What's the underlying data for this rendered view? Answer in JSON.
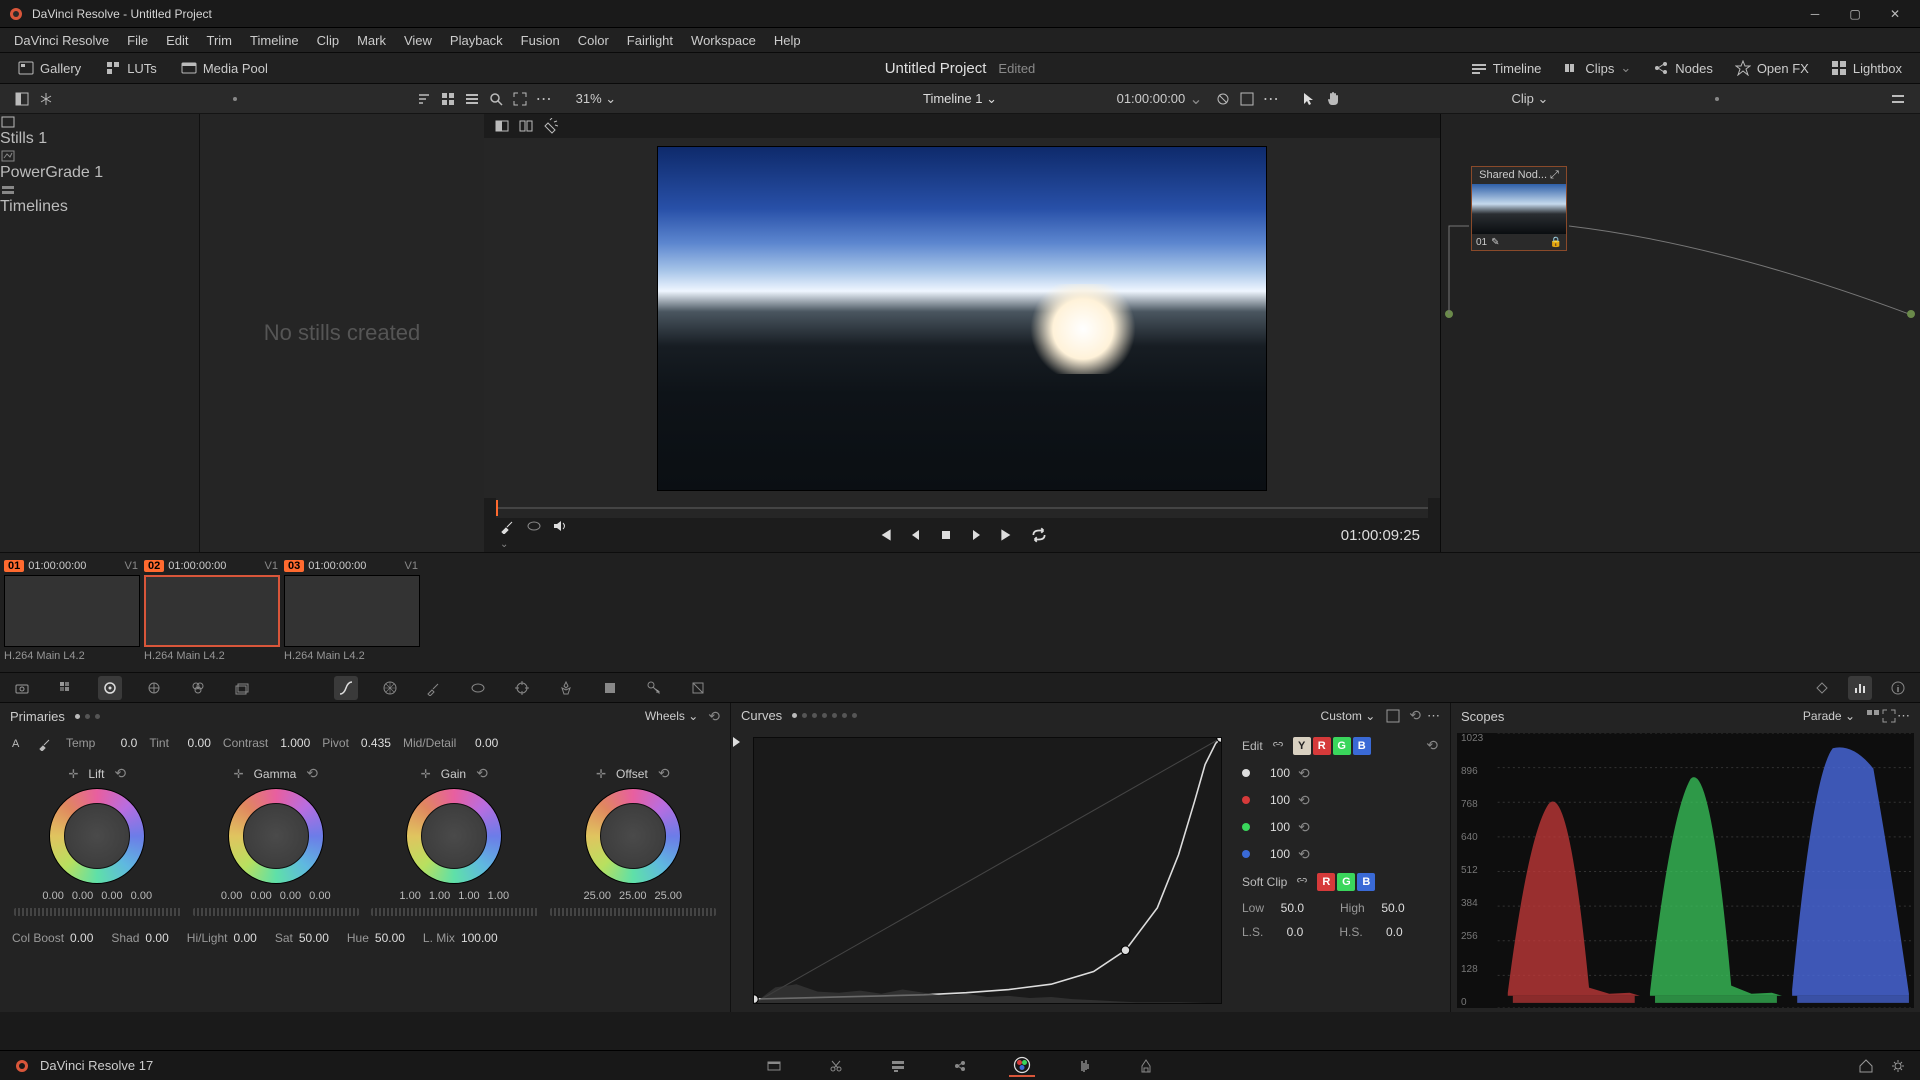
{
  "titlebar": {
    "title": "DaVinci Resolve - Untitled Project"
  },
  "menu": [
    "DaVinci Resolve",
    "File",
    "Edit",
    "Trim",
    "Timeline",
    "Clip",
    "Mark",
    "View",
    "Playback",
    "Fusion",
    "Color",
    "Fairlight",
    "Workspace",
    "Help"
  ],
  "toolbar": {
    "left": [
      {
        "label": "Gallery",
        "icon": "gallery"
      },
      {
        "label": "LUTs",
        "icon": "luts"
      },
      {
        "label": "Media Pool",
        "icon": "mediapool"
      }
    ],
    "project": "Untitled Project",
    "edited": "Edited",
    "right": [
      {
        "label": "Timeline",
        "icon": "timeline"
      },
      {
        "label": "Clips",
        "icon": "clips"
      },
      {
        "label": "Nodes",
        "icon": "nodes"
      },
      {
        "label": "Open FX",
        "icon": "openfx"
      },
      {
        "label": "Lightbox",
        "icon": "lightbox"
      }
    ]
  },
  "viewer": {
    "zoom": "31%",
    "timeline": "Timeline 1",
    "tc_in": "01:00:00:00",
    "tc": "01:00:09:25",
    "clip_scope": "Clip"
  },
  "gallery": {
    "items": [
      "Stills 1",
      "PowerGrade 1",
      "Timelines"
    ],
    "empty": "No stills created"
  },
  "node": {
    "title": "Shared Nod...",
    "footer": "01"
  },
  "clips": [
    {
      "n": "01",
      "tc": "01:00:00:00",
      "track": "V1",
      "codec": "H.264 Main L4.2",
      "cls": "c1"
    },
    {
      "n": "02",
      "tc": "01:00:00:00",
      "track": "V1",
      "codec": "H.264 Main L4.2",
      "cls": "c2",
      "sel": true
    },
    {
      "n": "03",
      "tc": "01:00:00:00",
      "track": "V1",
      "codec": "H.264 Main L4.2",
      "cls": "c3"
    }
  ],
  "primaries": {
    "title": "Primaries",
    "mode": "Wheels",
    "top": [
      {
        "l": "Temp",
        "v": "0.0"
      },
      {
        "l": "Tint",
        "v": "0.00"
      },
      {
        "l": "Contrast",
        "v": "1.000"
      },
      {
        "l": "Pivot",
        "v": "0.435"
      },
      {
        "l": "Mid/Detail",
        "v": "0.00"
      }
    ],
    "wheels": [
      {
        "name": "Lift",
        "vals": [
          "0.00",
          "0.00",
          "0.00",
          "0.00"
        ]
      },
      {
        "name": "Gamma",
        "vals": [
          "0.00",
          "0.00",
          "0.00",
          "0.00"
        ]
      },
      {
        "name": "Gain",
        "vals": [
          "1.00",
          "1.00",
          "1.00",
          "1.00"
        ]
      },
      {
        "name": "Offset",
        "vals": [
          "25.00",
          "25.00",
          "25.00"
        ]
      }
    ],
    "bottom": [
      {
        "l": "Col Boost",
        "v": "0.00"
      },
      {
        "l": "Shad",
        "v": "0.00"
      },
      {
        "l": "Hi/Light",
        "v": "0.00"
      },
      {
        "l": "Sat",
        "v": "50.00"
      },
      {
        "l": "Hue",
        "v": "50.00"
      },
      {
        "l": "L. Mix",
        "v": "100.00"
      }
    ]
  },
  "curves": {
    "title": "Curves",
    "mode": "Custom",
    "edit": "Edit",
    "softclip": "Soft Clip",
    "gains": [
      "100",
      "100",
      "100",
      "100"
    ],
    "sc": [
      {
        "l": "Low",
        "v": "50.0"
      },
      {
        "l": "High",
        "v": "50.0"
      },
      {
        "l": "L.S.",
        "v": "0.0"
      },
      {
        "l": "H.S.",
        "v": "0.0"
      }
    ]
  },
  "scopes": {
    "title": "Scopes",
    "mode": "Parade",
    "ticks": [
      "1023",
      "896",
      "768",
      "640",
      "512",
      "384",
      "256",
      "128",
      "0"
    ]
  },
  "footer": {
    "version": "DaVinci Resolve 17"
  }
}
